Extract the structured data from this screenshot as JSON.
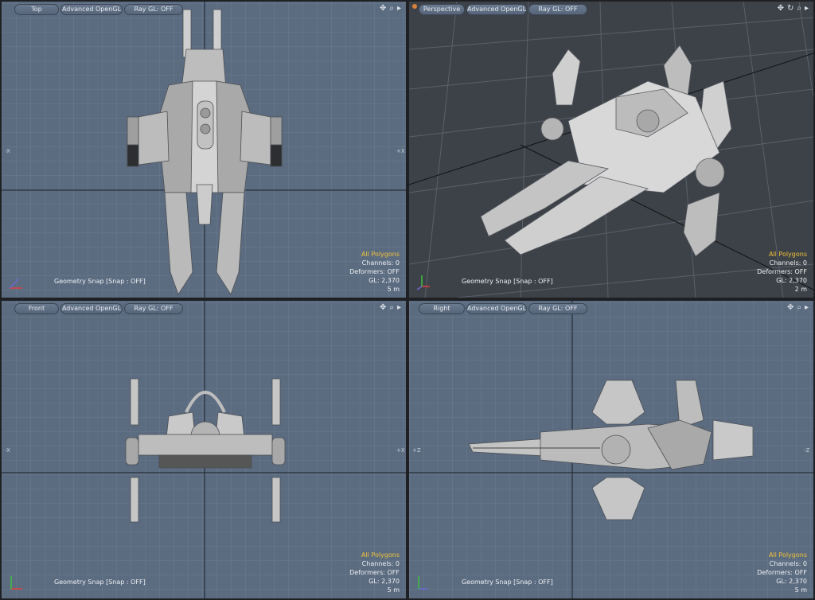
{
  "viewports": {
    "top": {
      "view_label": "Top",
      "render_mode": "Advanced OpenGL",
      "raygl": "Ray GL: OFF",
      "snap": "Geometry Snap  [Snap : OFF]",
      "info": {
        "selection": "All Polygons",
        "channels": "Channels: 0",
        "deformers": "Deformers: OFF",
        "gl": "GL: 2,370",
        "scale": "5 m"
      },
      "axis_left": "-X",
      "axis_right": "+X"
    },
    "perspective": {
      "view_label": "Perspective",
      "render_mode": "Advanced OpenGL",
      "raygl": "Ray GL: OFF",
      "snap": "Geometry Snap  [Snap : OFF]",
      "info": {
        "selection": "All Polygons",
        "channels": "Channels: 0",
        "deformers": "Deformers: OFF",
        "gl": "GL: 2,370",
        "scale": "2 m"
      }
    },
    "front": {
      "view_label": "Front",
      "render_mode": "Advanced OpenGL",
      "raygl": "Ray GL: OFF",
      "snap": "Geometry Snap  [Snap : OFF]",
      "info": {
        "selection": "All Polygons",
        "channels": "Channels: 0",
        "deformers": "Deformers: OFF",
        "gl": "GL: 2,370",
        "scale": "5 m"
      },
      "axis_left": "-X",
      "axis_right": "+X"
    },
    "right": {
      "view_label": "Right",
      "render_mode": "Advanced OpenGL",
      "raygl": "Ray GL: OFF",
      "snap": "Geometry Snap  [Snap : OFF]",
      "info": {
        "selection": "All Polygons",
        "channels": "Channels: 0",
        "deformers": "Deformers: OFF",
        "gl": "GL: 2,370",
        "scale": "5 m"
      },
      "axis_left": "+Z",
      "axis_right": "-Z"
    }
  },
  "icons": [
    "pan-icon",
    "rotate-icon",
    "zoom-icon",
    "menu-arrow-icon"
  ],
  "colors": {
    "viewport_bg": "#5b6b80",
    "perspective_bg": "#3d4249",
    "highlight": "#f2c43a"
  }
}
